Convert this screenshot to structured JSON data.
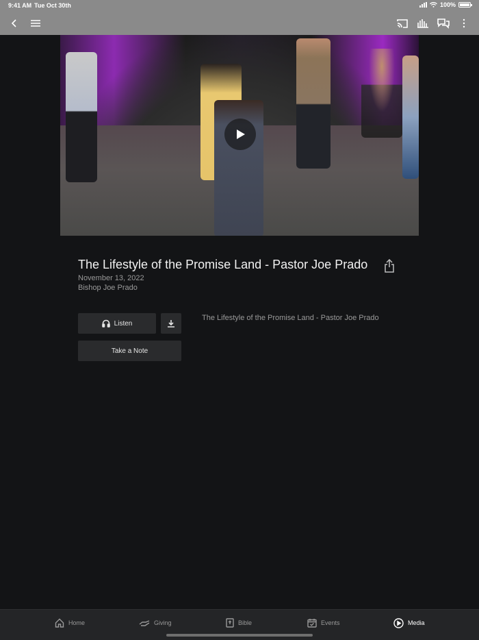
{
  "status_bar": {
    "time": "9:41 AM",
    "date": "Tue Oct 30th",
    "battery": "100%"
  },
  "nav": {
    "back_icon": "chevron-left-icon",
    "menu_icon": "hamburger-icon",
    "cast_icon": "cast-icon",
    "audio_icon": "audio-bars-icon",
    "chat_icon": "chat-bubbles-icon",
    "more_icon": "more-vertical-icon"
  },
  "media": {
    "title": "The Lifestyle of the Promise Land - Pastor Joe Prado",
    "date": "November 13, 2022",
    "speaker": "Bishop Joe Prado",
    "description": "The Lifestyle of the Promise Land - Pastor Joe Prado",
    "listen_label": "Listen",
    "note_label": "Take a Note"
  },
  "tabs": [
    {
      "label": "Home",
      "icon": "home-icon"
    },
    {
      "label": "Giving",
      "icon": "giving-hand-icon"
    },
    {
      "label": "Bible",
      "icon": "bible-icon"
    },
    {
      "label": "Events",
      "icon": "calendar-icon"
    },
    {
      "label": "Media",
      "icon": "play-circle-icon",
      "active": true
    }
  ],
  "colors": {
    "background": "#131416",
    "nav_bar": "#8a8a8a",
    "button": "#2a2b2d",
    "tab_bar": "#242527",
    "muted_text": "#9a9a9a"
  }
}
